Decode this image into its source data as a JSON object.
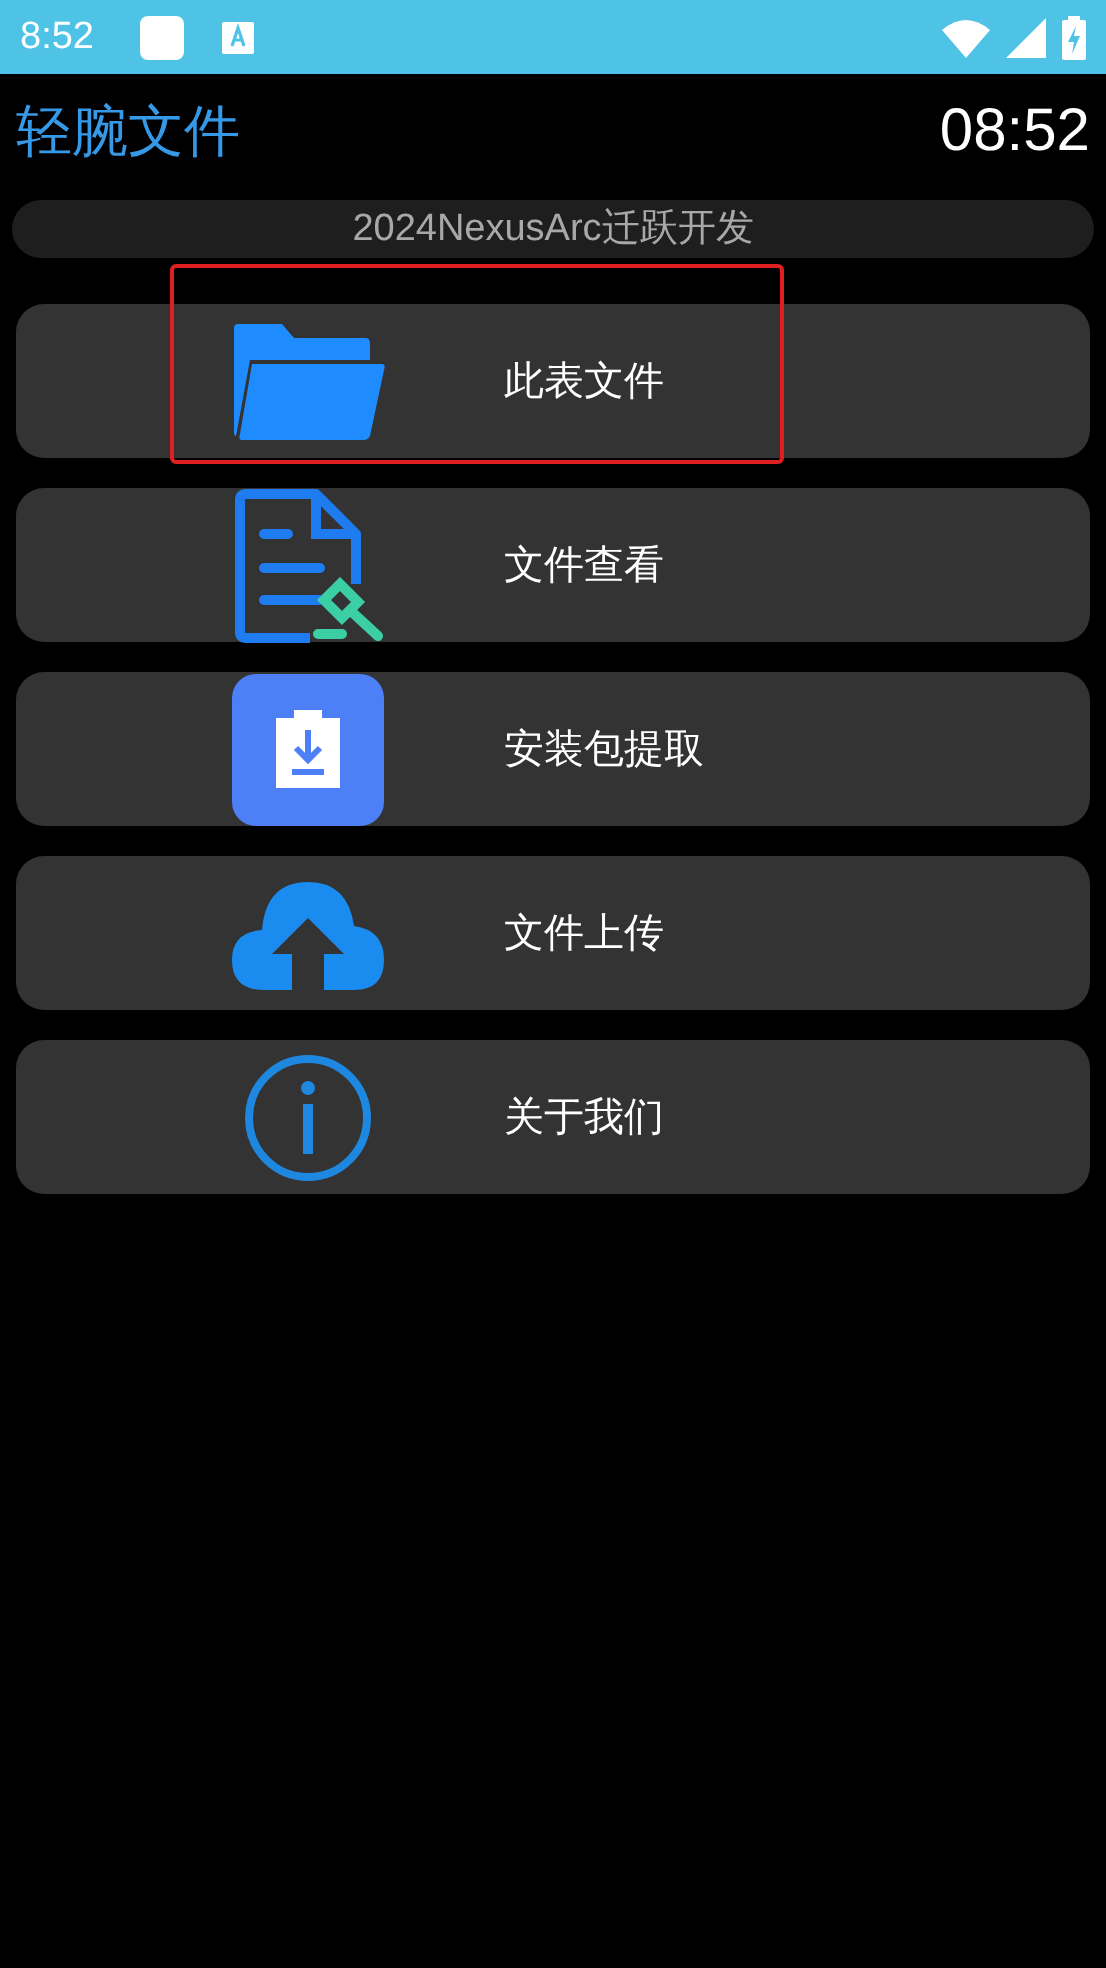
{
  "status_bar": {
    "time": "8:52"
  },
  "header": {
    "title": "轻腕文件",
    "clock": "08:52"
  },
  "banner": {
    "text": "2024NexusArc迁跃开发"
  },
  "items": [
    {
      "kind": "folder",
      "label": "此表文件",
      "highlighted": true
    },
    {
      "kind": "document",
      "label": "文件查看",
      "highlighted": false
    },
    {
      "kind": "package",
      "label": "安装包提取",
      "highlighted": false
    },
    {
      "kind": "upload",
      "label": "文件上传",
      "highlighted": false
    },
    {
      "kind": "info",
      "label": "关于我们",
      "highlighted": false
    }
  ]
}
